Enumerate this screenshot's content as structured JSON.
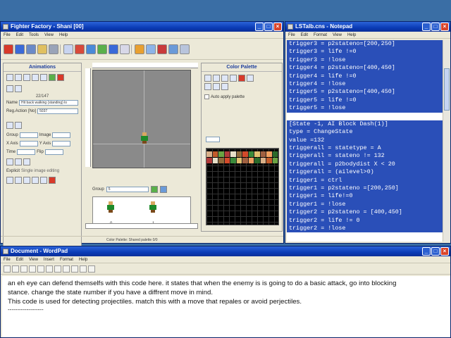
{
  "fighter_factory": {
    "title": "Fighter Factory - Shani [00]",
    "menu": [
      "File",
      "Edit",
      "Tools",
      "View",
      "Help"
    ],
    "animations_title": "Animations",
    "frame_counter": "22/147",
    "name_label": "Name",
    "name_value": "Hit back walking (standing) lo",
    "reg_action_label": "Reg.Action [No]",
    "reg_action_value": "5037",
    "group_label": "Group",
    "image_label": "Image",
    "xaxis_label": "X Axis",
    "yaxis_label": "Y Axis",
    "time_label": "Time",
    "flip_label": "Flip",
    "explicit_label": "Explicit",
    "clsn_label": "Single image editing",
    "canvas_group_label": "Group",
    "canvas_group_value": "5",
    "thumb_labels": [
      "0",
      "1"
    ],
    "palette_title": "Color Palette",
    "apply_palette_label": "Auto apply palette",
    "status": "Color Palette: Shared palette    0/0",
    "palette_colors": [
      "#d9b089",
      "#c25b2a",
      "#6aa343",
      "#b03a3a",
      "#e8e0c8",
      "#8f6a3a",
      "#d24a2a",
      "#3a8a3a",
      "#e0c070",
      "#a06040",
      "#f0a060",
      "#2a6a2a"
    ]
  },
  "notepad_cns": {
    "title": "LSTalb.cns - Notepad",
    "menu": [
      "File",
      "Edit",
      "Format",
      "View",
      "Help"
    ],
    "lines": [
      "trigger3 = p2stateno=[200,250]",
      "trigger3 = life !=0",
      "trigger3 = !lose",
      "trigger4 = p2stateno=[400,450]",
      "trigger4 = life !=0",
      "trigger4 = !lose",
      "trigger5 = p2stateno=[400,450]",
      "trigger5 = life !=0",
      "trigger5 = !lose",
      "",
      "[State -1, AI Block Dash(1)]",
      "type = ChangeState",
      "value =132",
      "triggerall = statetype = A",
      "triggerall = stateno != 132",
      "triggerall = p2bodydist X < 20",
      "triggerall = (ailevel>0)",
      "trigger1 = ctrl",
      "trigger1 = p2stateno =[200,250]",
      "trigger1 = life!=0",
      "trigger1 = !lose",
      "trigger2 = p2stateno = [400,450]",
      "trigger2 = life != 0",
      "trigger2 = !lose"
    ]
  },
  "notepad_notes": {
    "title": "Document - WordPad",
    "menu": [
      "File",
      "Edit",
      "View",
      "Insert",
      "Format",
      "Help"
    ],
    "lines": [
      "an eh eye can defend themselfs with this code here. it states that when the enemy is is going to do a basic attack, go into blocking",
      "stance. change the state number if you have a diffrent move in mind.",
      "This code is used for detecting projectiles. match this with a move that repales or avoid perjectiles.",
      "-------------------"
    ]
  }
}
